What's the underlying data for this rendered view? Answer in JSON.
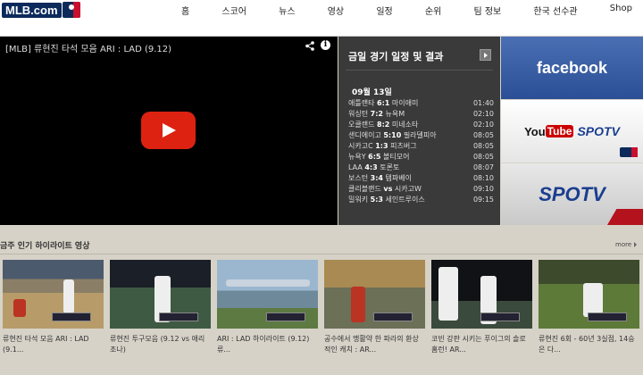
{
  "brand": {
    "logo_text": "MLB.com"
  },
  "nav": {
    "items": [
      "홈",
      "스코어",
      "뉴스",
      "영상",
      "일정",
      "순위",
      "팀 정보",
      "한국 선수관",
      "Shop"
    ]
  },
  "video": {
    "title": "[MLB] 류현진 타석 모음 ARI : LAD (9.12)"
  },
  "schedule": {
    "title": "금일 경기 일정 및 결과",
    "date": "09월 13일",
    "games": [
      {
        "away": "애틀랜타",
        "score": "6:1",
        "home": "마이애미",
        "time": "01:40"
      },
      {
        "away": "워싱턴",
        "score": "7:2",
        "home": "뉴욕M",
        "time": "02:10"
      },
      {
        "away": "오클랜드",
        "score": "8:2",
        "home": "미네소타",
        "time": "02:10"
      },
      {
        "away": "샌디에이고",
        "score": "5:10",
        "home": "필라델피아",
        "time": "08:05"
      },
      {
        "away": "시카고C",
        "score": "1:3",
        "home": "피츠버그",
        "time": "08:05"
      },
      {
        "away": "뉴욕Y",
        "score": "6:5",
        "home": "볼티모어",
        "time": "08:05"
      },
      {
        "away": "LAA",
        "score": "4:3",
        "home": "토론토",
        "time": "08:07"
      },
      {
        "away": "보스턴",
        "score": "3:4",
        "home": "탬파베이",
        "time": "08:10"
      },
      {
        "away": "클리블랜드",
        "score": "vs",
        "home": "시카고W",
        "time": "09:10"
      },
      {
        "away": "밀워키",
        "score": "5:3",
        "home": "세인트루이스",
        "time": "09:15"
      }
    ]
  },
  "ads": {
    "facebook": "facebook",
    "youtube_you": "You",
    "youtube_tube": "Tube",
    "spotv": "SPOTV"
  },
  "highlights": {
    "title": "금주 인기 하이라이트 영상",
    "more_label": "more",
    "items": [
      {
        "caption": "류현진 타석 모음 ARI : LAD (9.1..."
      },
      {
        "caption": "류현진 투구모음 (9.12 vs 애리조나)"
      },
      {
        "caption": "ARI : LAD 하이라이트 (9.12) 류..."
      },
      {
        "caption": "공수에서 맹활약 한 파라의 환상적인 캐치 : AR..."
      },
      {
        "caption": "코빈 강판 시키는 푸이그의 솔로 홈런! AR..."
      },
      {
        "caption": "류현진 6회 - 60년 3실점, 14승은 다..."
      }
    ]
  },
  "colors": {
    "accent": "#c8102e",
    "brand_navy": "#0b2a5b",
    "schedule_bg": "#3a3a3a"
  }
}
